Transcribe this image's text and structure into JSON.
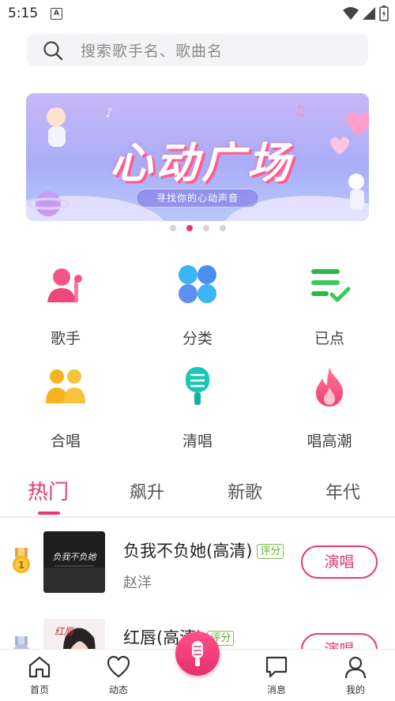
{
  "status_bar": {
    "time": "5:15",
    "notification_icon": "A"
  },
  "search": {
    "placeholder": "搜索歌手名、歌曲名"
  },
  "banner": {
    "title": "心动广场",
    "subtitle": "寻找你的心动声音",
    "dots_total": 4,
    "dots_active_index": 1
  },
  "categories": [
    {
      "label": "歌手",
      "icon": "singer-icon",
      "color": "#f0477a"
    },
    {
      "label": "分类",
      "icon": "category-icon",
      "color": "#4a8ff0"
    },
    {
      "label": "已点",
      "icon": "requested-list-icon",
      "color": "#2bb84a"
    },
    {
      "label": "合唱",
      "icon": "chorus-icon",
      "color": "#f6b21f"
    },
    {
      "label": "清唱",
      "icon": "microphone-icon",
      "color": "#19c7b4"
    },
    {
      "label": "唱高潮",
      "icon": "flame-icon",
      "color": "#f0477a"
    }
  ],
  "tabs": [
    {
      "label": "热门",
      "active": true
    },
    {
      "label": "飙升",
      "active": false
    },
    {
      "label": "新歌",
      "active": false
    },
    {
      "label": "年代",
      "active": false
    }
  ],
  "songs": [
    {
      "rank": "1",
      "title": "负我不负她(高清)",
      "badge": "评分",
      "artist": "赵洋",
      "cover_text": "负我不负她",
      "action": "演唱"
    },
    {
      "rank": "2",
      "title": "红唇(高清)",
      "badge": "评分",
      "artist": "",
      "cover_text": "红唇",
      "action": "演唱"
    }
  ],
  "bottom_nav": [
    {
      "label": "首页"
    },
    {
      "label": "动态"
    },
    {
      "label": "消息"
    },
    {
      "label": "我的"
    }
  ],
  "colors": {
    "accent": "#e8396e",
    "badge_green": "#5fae2e"
  }
}
